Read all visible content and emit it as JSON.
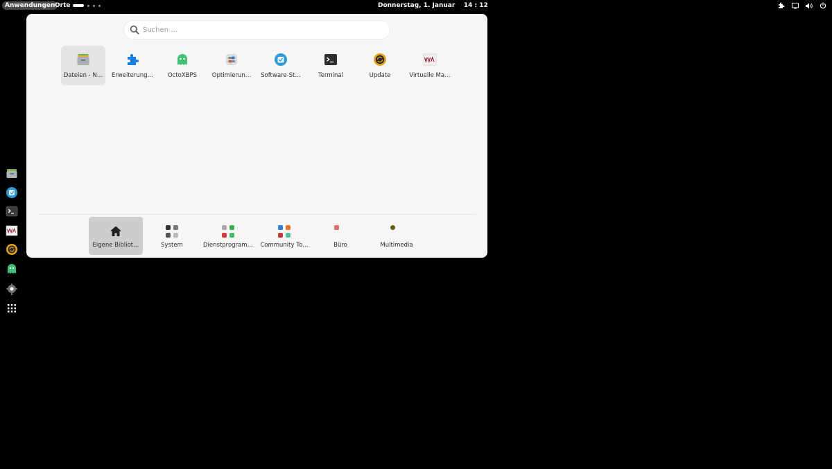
{
  "topbar": {
    "activities_label": "Anwendungen",
    "places_label": "Orte",
    "clock": "Donnerstag, 1. Januar    14 : 12",
    "tray_icons": [
      "extension-icon",
      "screen-icon",
      "volume-icon",
      "power-icon"
    ]
  },
  "search": {
    "placeholder": "Suchen …"
  },
  "apps": [
    {
      "label": "Dateien - N…",
      "icon": "archive-icon"
    },
    {
      "label": "Erweiterung…",
      "icon": "puzzle-icon"
    },
    {
      "label": "OctoXBPS",
      "icon": "ghost-icon"
    },
    {
      "label": "Optimierun…",
      "icon": "tweaks-icon"
    },
    {
      "label": "Software-St…",
      "icon": "store-icon"
    },
    {
      "label": "Terminal",
      "icon": "terminal-icon"
    },
    {
      "label": "Update",
      "icon": "update-icon"
    },
    {
      "label": "Virtuelle Ma…",
      "icon": "vm-icon"
    }
  ],
  "categories": [
    {
      "label": "Eigene Bibliot…",
      "icon": "home-icon"
    },
    {
      "label": "System",
      "icon": "system-folder-icon"
    },
    {
      "label": "Dienstprogram…",
      "icon": "utilities-folder-icon"
    },
    {
      "label": "Community To…",
      "icon": "community-folder-icon"
    },
    {
      "label": "Büro",
      "icon": "office-folder-icon"
    },
    {
      "label": "Multimedia",
      "icon": "multimedia-folder-icon"
    }
  ],
  "dash": [
    "files-icon",
    "store-icon",
    "terminal-icon",
    "vm-icon",
    "update-icon",
    "ghost-icon",
    "settings-icon",
    "app-grid-icon"
  ]
}
